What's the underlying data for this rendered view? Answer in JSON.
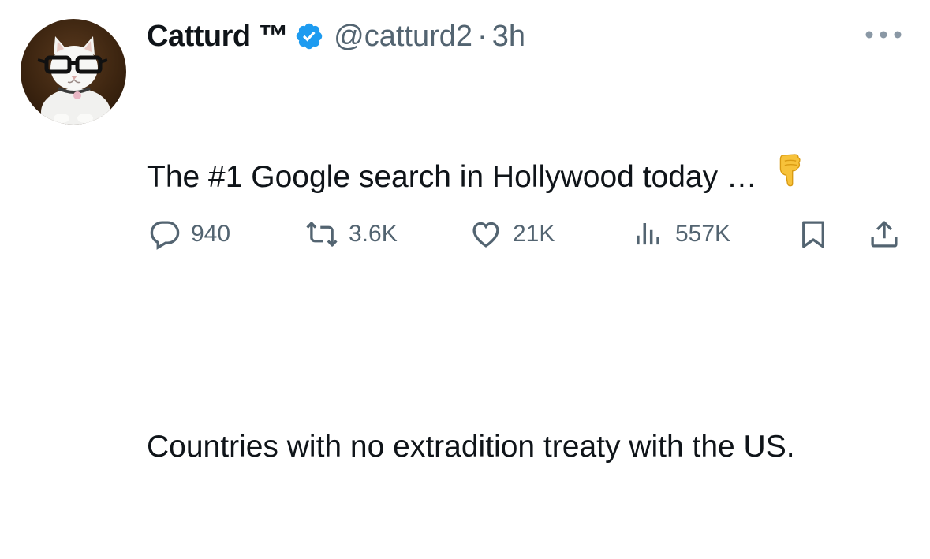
{
  "author": {
    "display_name": "Catturd ™",
    "handle": "@catturd2",
    "separator": "·",
    "time": "3h",
    "verified": true,
    "badge_color": "#1d9bf0"
  },
  "tweet": {
    "line1": "The #1 Google search in Hollywood today …",
    "line1_emoji": "backhand-index-pointing-down",
    "line2": "Countries with no extradition treaty with the US."
  },
  "actions": {
    "replies": "940",
    "retweets": "3.6K",
    "likes": "21K",
    "views": "557K"
  },
  "colors": {
    "text": "#0f1419",
    "secondary": "#536471"
  }
}
